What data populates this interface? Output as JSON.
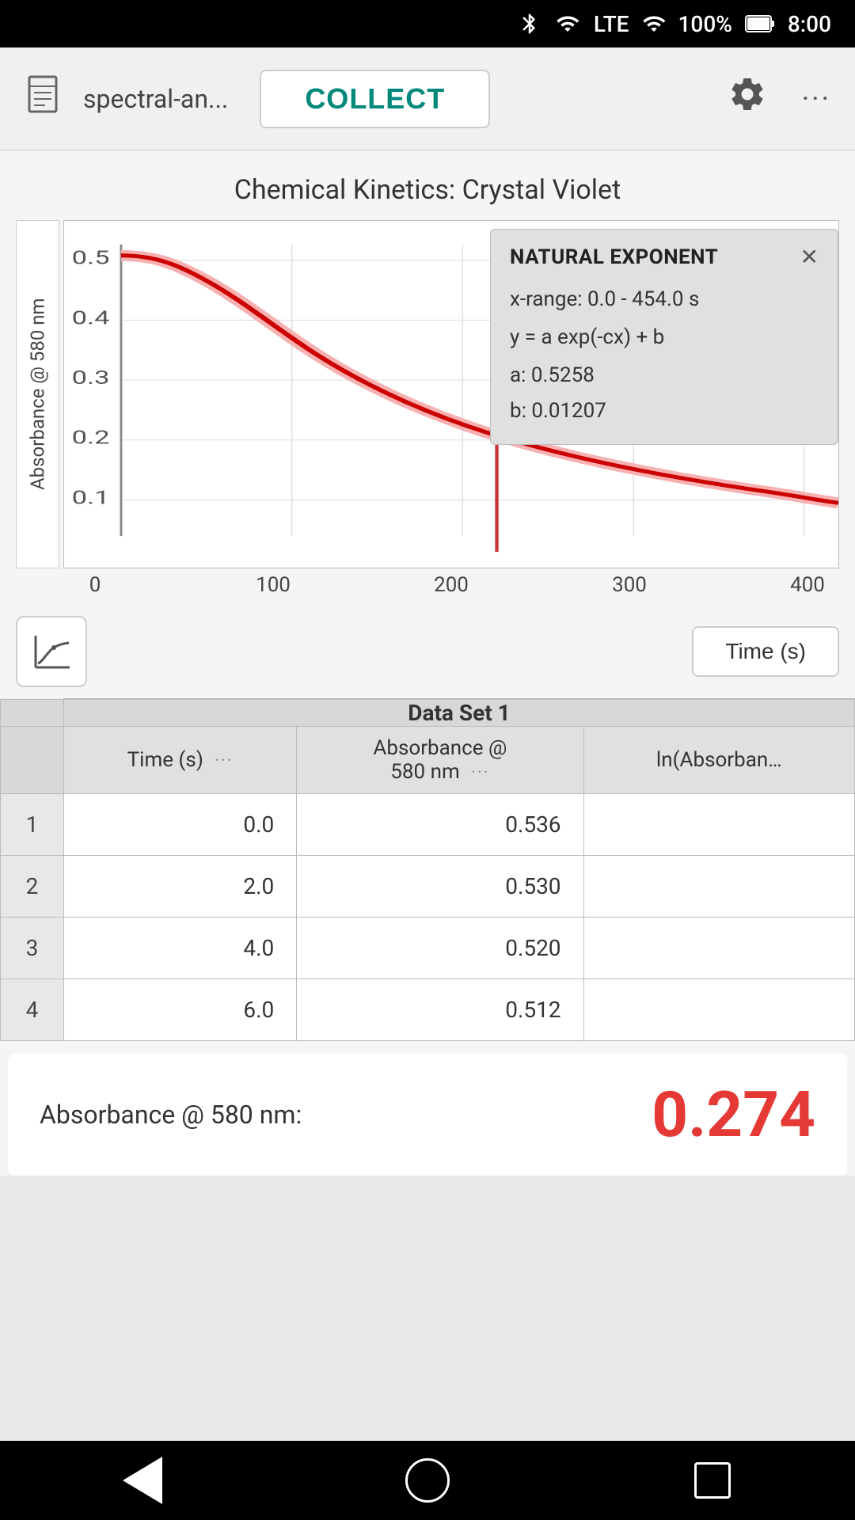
{
  "statusBar": {
    "battery": "100%",
    "time": "8:00",
    "signal": "LTE"
  },
  "topBar": {
    "fileTitle": "spectral-an...",
    "collectLabel": "COLLECT"
  },
  "chart": {
    "title": "Chemical Kinetics: Crystal Violet",
    "yAxisLabel": "Absorbance @ 580 nm",
    "xAxisLabels": [
      "0",
      "100",
      "200",
      "300",
      "400"
    ],
    "yAxisTicks": [
      "0.5",
      "0.4",
      "0.3",
      "0.2",
      "0.1"
    ],
    "tooltip": {
      "title": "NATURAL EXPONENT",
      "xRange": "x-range: 0.0 - 454.0 s",
      "formula": "y = a exp(-cx) + b",
      "paramA": "a: 0.5258",
      "paramB": "b: 0.01207"
    },
    "xAxisButtonLabel": "Time (s)"
  },
  "table": {
    "datasetLabel": "Data Set 1",
    "columns": [
      {
        "header": "Time (s)",
        "dots": "···"
      },
      {
        "header": "Absorbance @\n580 nm",
        "dots": "···"
      },
      {
        "header": "ln(Absorban…",
        "dots": ""
      }
    ],
    "rows": [
      {
        "num": "1",
        "time": "0.0",
        "absorbance": "0.536",
        "ln": ""
      },
      {
        "num": "2",
        "time": "2.0",
        "absorbance": "0.530",
        "ln": ""
      },
      {
        "num": "3",
        "time": "4.0",
        "absorbance": "0.520",
        "ln": ""
      },
      {
        "num": "4",
        "time": "6.0",
        "absorbance": "0.512",
        "ln": ""
      }
    ]
  },
  "bottomReading": {
    "label": "Absorbance @ 580 nm:",
    "value": "0.274"
  },
  "navBar": {
    "back": "◀",
    "home": "○",
    "recent": "□"
  }
}
